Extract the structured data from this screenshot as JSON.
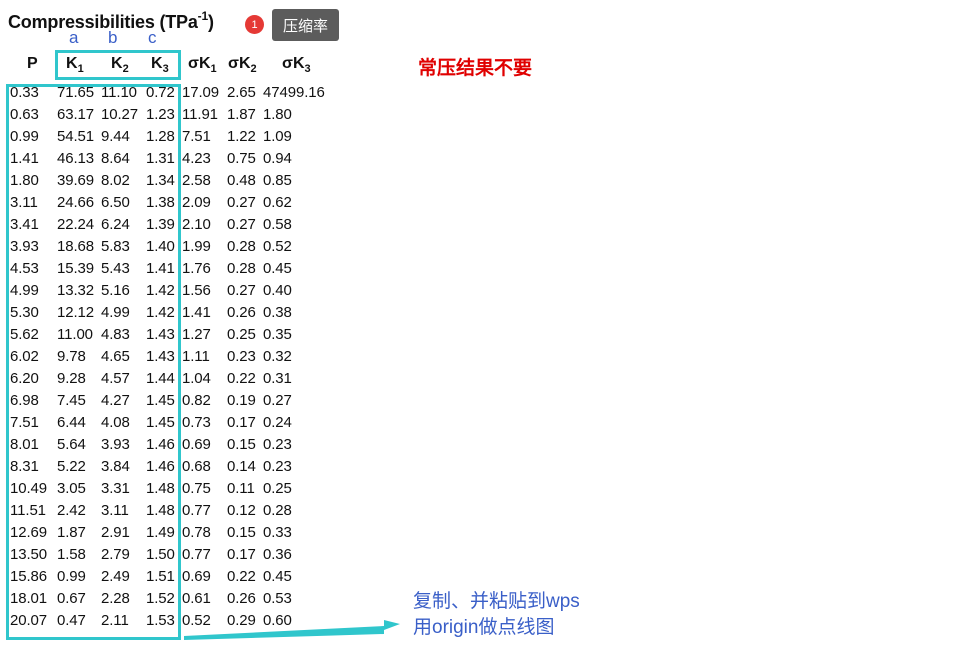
{
  "title": {
    "main": "Compressibilities (TPa",
    "sup": "-1",
    "close": ")"
  },
  "badge": {
    "count": "1"
  },
  "tooltip": {
    "text": "压缩率"
  },
  "annotations": {
    "col_letters": [
      "a",
      "b",
      "c"
    ],
    "red_note": "常压结果不要",
    "blue_note_line1": "复制、并粘贴到wps",
    "blue_note_line2": "用origin做点线图",
    "highlight_color": "#30c6cc",
    "note_blue": "#3a5fc8",
    "note_red": "#e00000"
  },
  "table": {
    "headers": [
      {
        "base": "P",
        "sub": ""
      },
      {
        "base": "K",
        "sub": "1"
      },
      {
        "base": "K",
        "sub": "2"
      },
      {
        "base": "K",
        "sub": "3"
      },
      {
        "base": "σK",
        "sub": "1"
      },
      {
        "base": "σK",
        "sub": "2"
      },
      {
        "base": "σK",
        "sub": "3"
      }
    ],
    "rows": [
      [
        "0.33",
        "71.65",
        "11.10",
        "0.72",
        "17.09",
        "2.65",
        "47499.16"
      ],
      [
        "0.63",
        "63.17",
        "10.27",
        "1.23",
        "11.91",
        "1.87",
        "1.80"
      ],
      [
        "0.99",
        "54.51",
        "9.44",
        "1.28",
        "7.51",
        "1.22",
        "1.09"
      ],
      [
        "1.41",
        "46.13",
        "8.64",
        "1.31",
        "4.23",
        "0.75",
        "0.94"
      ],
      [
        "1.80",
        "39.69",
        "8.02",
        "1.34",
        "2.58",
        "0.48",
        "0.85"
      ],
      [
        "3.11",
        "24.66",
        "6.50",
        "1.38",
        "2.09",
        "0.27",
        "0.62"
      ],
      [
        "3.41",
        "22.24",
        "6.24",
        "1.39",
        "2.10",
        "0.27",
        "0.58"
      ],
      [
        "3.93",
        "18.68",
        "5.83",
        "1.40",
        "1.99",
        "0.28",
        "0.52"
      ],
      [
        "4.53",
        "15.39",
        "5.43",
        "1.41",
        "1.76",
        "0.28",
        "0.45"
      ],
      [
        "4.99",
        "13.32",
        "5.16",
        "1.42",
        "1.56",
        "0.27",
        "0.40"
      ],
      [
        "5.30",
        "12.12",
        "4.99",
        "1.42",
        "1.41",
        "0.26",
        "0.38"
      ],
      [
        "5.62",
        "11.00",
        "4.83",
        "1.43",
        "1.27",
        "0.25",
        "0.35"
      ],
      [
        "6.02",
        "9.78",
        "4.65",
        "1.43",
        "1.11",
        "0.23",
        "0.32"
      ],
      [
        "6.20",
        "9.28",
        "4.57",
        "1.44",
        "1.04",
        "0.22",
        "0.31"
      ],
      [
        "6.98",
        "7.45",
        "4.27",
        "1.45",
        "0.82",
        "0.19",
        "0.27"
      ],
      [
        "7.51",
        "6.44",
        "4.08",
        "1.45",
        "0.73",
        "0.17",
        "0.24"
      ],
      [
        "8.01",
        "5.64",
        "3.93",
        "1.46",
        "0.69",
        "0.15",
        "0.23"
      ],
      [
        "8.31",
        "5.22",
        "3.84",
        "1.46",
        "0.68",
        "0.14",
        "0.23"
      ],
      [
        "10.49",
        "3.05",
        "3.31",
        "1.48",
        "0.75",
        "0.11",
        "0.25"
      ],
      [
        "11.51",
        "2.42",
        "3.11",
        "1.48",
        "0.77",
        "0.12",
        "0.28"
      ],
      [
        "12.69",
        "1.87",
        "2.91",
        "1.49",
        "0.78",
        "0.15",
        "0.33"
      ],
      [
        "13.50",
        "1.58",
        "2.79",
        "1.50",
        "0.77",
        "0.17",
        "0.36"
      ],
      [
        "15.86",
        "0.99",
        "2.49",
        "1.51",
        "0.69",
        "0.22",
        "0.45"
      ],
      [
        "18.01",
        "0.67",
        "2.28",
        "1.52",
        "0.61",
        "0.26",
        "0.53"
      ],
      [
        "20.07",
        "0.47",
        "2.11",
        "1.53",
        "0.52",
        "0.29",
        "0.60"
      ]
    ]
  }
}
